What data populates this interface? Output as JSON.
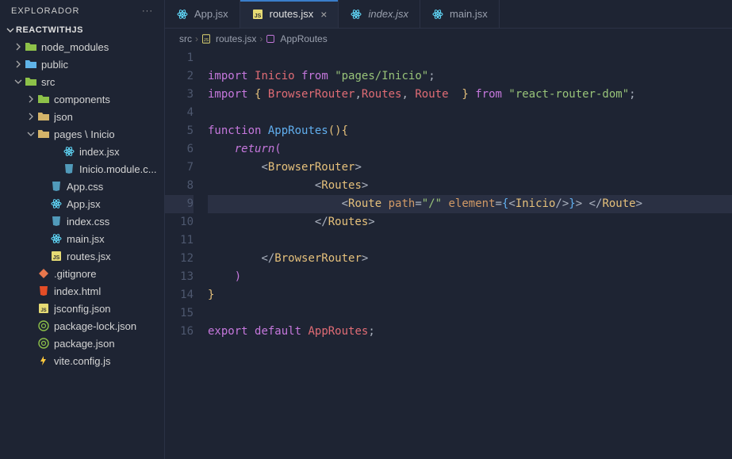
{
  "explorer": {
    "title": "EXPLORADOR",
    "project": "REACTWITHJS"
  },
  "tree": [
    {
      "label": "node_modules",
      "type": "folder",
      "icon": "folder-green",
      "indent": 1,
      "chev": "right"
    },
    {
      "label": "public",
      "type": "folder",
      "icon": "folder-blue",
      "indent": 1,
      "chev": "right"
    },
    {
      "label": "src",
      "type": "folder",
      "icon": "folder-green",
      "indent": 1,
      "chev": "down",
      "selected": false
    },
    {
      "label": "components",
      "type": "folder",
      "icon": "folder-green",
      "indent": 2,
      "chev": "right"
    },
    {
      "label": "json",
      "type": "folder",
      "icon": "folder-yellow",
      "indent": 2,
      "chev": "right"
    },
    {
      "label": "pages \\ Inicio",
      "type": "folder",
      "icon": "folder-yellow",
      "indent": 2,
      "chev": "down"
    },
    {
      "label": "index.jsx",
      "type": "file",
      "icon": "react",
      "indent": 4
    },
    {
      "label": "Inicio.module.c...",
      "type": "file",
      "icon": "css",
      "indent": 4
    },
    {
      "label": "App.css",
      "type": "file",
      "icon": "css",
      "indent": 3
    },
    {
      "label": "App.jsx",
      "type": "file",
      "icon": "react",
      "indent": 3
    },
    {
      "label": "index.css",
      "type": "file",
      "icon": "css",
      "indent": 3
    },
    {
      "label": "main.jsx",
      "type": "file",
      "icon": "react",
      "indent": 3
    },
    {
      "label": "routes.jsx",
      "type": "file",
      "icon": "js",
      "indent": 3
    },
    {
      "label": ".gitignore",
      "type": "file",
      "icon": "git",
      "indent": 2
    },
    {
      "label": "index.html",
      "type": "file",
      "icon": "html",
      "indent": 2
    },
    {
      "label": "jsconfig.json",
      "type": "file",
      "icon": "json-js",
      "indent": 2
    },
    {
      "label": "package-lock.json",
      "type": "file",
      "icon": "json",
      "indent": 2
    },
    {
      "label": "package.json",
      "type": "file",
      "icon": "json",
      "indent": 2
    },
    {
      "label": "vite.config.js",
      "type": "file",
      "icon": "vite",
      "indent": 2
    }
  ],
  "tabs": [
    {
      "label": "App.jsx",
      "icon": "react",
      "active": false
    },
    {
      "label": "routes.jsx",
      "icon": "js",
      "active": true,
      "close": true
    },
    {
      "label": "index.jsx",
      "icon": "react",
      "active": false,
      "italic": true
    },
    {
      "label": "main.jsx",
      "icon": "react",
      "active": false
    }
  ],
  "breadcrumb": {
    "parts": [
      "src",
      "routes.jsx",
      "AppRoutes"
    ],
    "icons": [
      "",
      "js",
      "fn"
    ]
  },
  "editor": {
    "highlighted_line": 9,
    "lines": [
      {
        "n": 1,
        "html": ""
      },
      {
        "n": 2,
        "html": "<span class='tok-imp'>import</span> <span class='tok-name'>Inicio</span> <span class='tok-imp'>from</span> <span class='tok-str'>\"pages/Inicio\"</span><span class='tok-pun'>;</span>"
      },
      {
        "n": 3,
        "html": "<span class='tok-imp'>import</span> <span class='tok-yellow'>{</span> <span class='tok-name'>BrowserRouter</span><span class='tok-pun'>,</span><span class='tok-name'>Routes</span><span class='tok-pun'>,</span> <span class='tok-name'>Route</span>  <span class='tok-yellow'>}</span> <span class='tok-imp'>from</span> <span class='tok-str'>\"react-router-dom\"</span><span class='tok-pun'>;</span>"
      },
      {
        "n": 4,
        "html": ""
      },
      {
        "n": 5,
        "html": "<span class='tok-key'>function</span> <span class='tok-fn'>AppRoutes</span><span class='tok-yellow'>(</span><span class='tok-yellow'>)</span><span class='tok-yellow'>{</span>"
      },
      {
        "n": 6,
        "html": "<span class='ws'>····</span><span class='tok-ret'>return</span><span class='tok-key'>(</span>"
      },
      {
        "n": 7,
        "html": "<span class='ws'>········</span><span class='tok-pun'>&lt;</span><span class='tok-yellow'>BrowserRouter</span><span class='tok-pun'>&gt;</span>"
      },
      {
        "n": 8,
        "html": "<span class='ws'>················</span><span class='tok-pun'>&lt;</span><span class='tok-yellow'>Routes</span><span class='tok-pun'>&gt;</span>"
      },
      {
        "n": 9,
        "html": "<span class='ws'>····················</span><span class='tok-pun'>&lt;</span><span class='tok-yellow'>Route</span> <span class='tok-attr'>path</span><span class='tok-pun'>=</span><span class='tok-str'>\"/\"</span> <span class='tok-attr'>element</span><span class='tok-pun'>=</span><span class='tok-fn'>{</span><span class='tok-pun'>&lt;</span><span class='tok-yellow'>Inicio</span><span class='tok-pun'>/&gt;</span><span class='tok-fn'>}</span><span class='tok-pun'>&gt;</span> <span class='tok-pun'>&lt;/</span><span class='tok-yellow'>Route</span><span class='tok-pun'>&gt;</span>"
      },
      {
        "n": 10,
        "html": "<span class='ws'>················</span><span class='tok-pun'>&lt;/</span><span class='tok-yellow'>Routes</span><span class='tok-pun'>&gt;</span>"
      },
      {
        "n": 11,
        "html": ""
      },
      {
        "n": 12,
        "html": "<span class='ws'>········</span><span class='tok-pun'>&lt;/</span><span class='tok-yellow'>BrowserRouter</span><span class='tok-pun'>&gt;</span>"
      },
      {
        "n": 13,
        "html": "<span class='ws'>····</span><span class='tok-key'>)</span>"
      },
      {
        "n": 14,
        "html": "<span class='tok-yellow'>}</span>"
      },
      {
        "n": 15,
        "html": ""
      },
      {
        "n": 16,
        "html": "<span class='tok-imp'>export</span> <span class='tok-imp'>default</span> <span class='tok-name'>AppRoutes</span><span class='tok-pun'>;</span>"
      }
    ]
  }
}
